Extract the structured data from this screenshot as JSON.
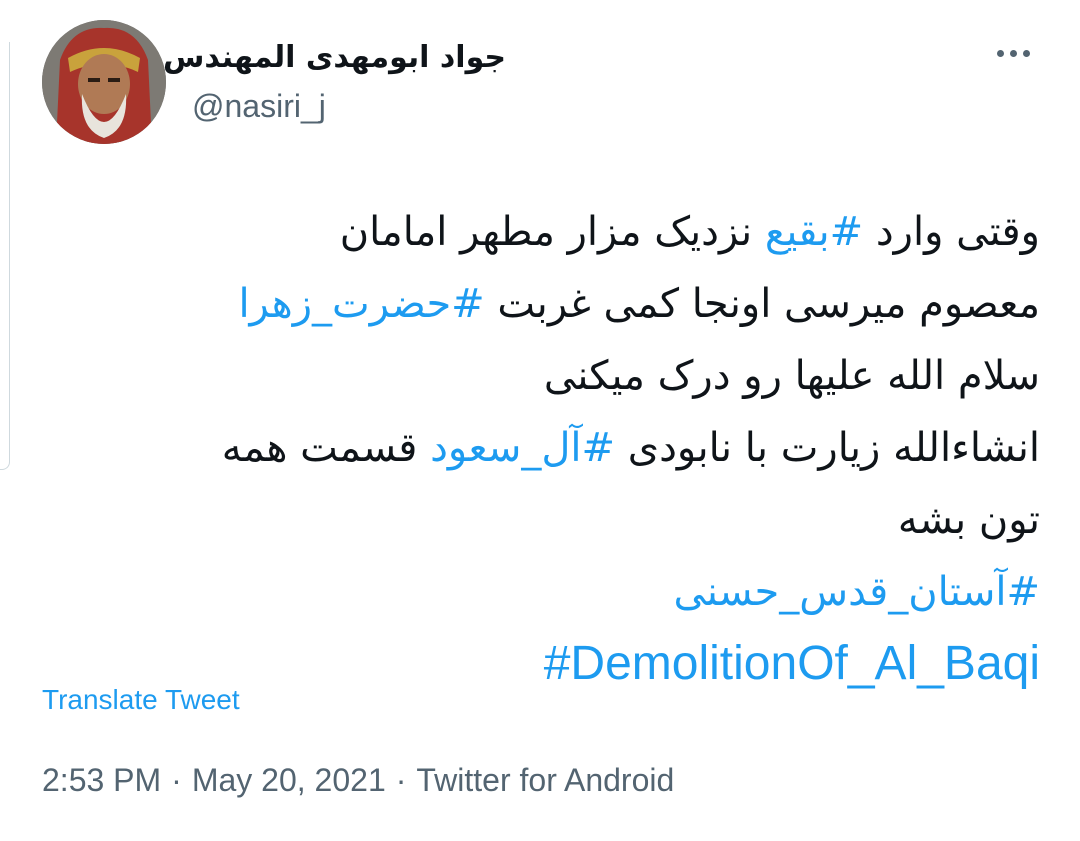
{
  "author": {
    "display_name": "جواد ابومهدی المهندس",
    "handle": "@nasiri_j"
  },
  "tweet": {
    "lines": [
      [
        {
          "t": "وقتی وارد ",
          "tag": false
        },
        {
          "t": "#بقیع",
          "tag": true
        },
        {
          "t": " نزدیک مزار مطهر امامان",
          "tag": false
        }
      ],
      [
        {
          "t": "معصوم میرسی اونجا کمی غربت ",
          "tag": false
        },
        {
          "t": "#حضرت_زهرا",
          "tag": true
        }
      ],
      [
        {
          "t": "سلام الله علیها رو درک میکنی",
          "tag": false
        }
      ],
      [
        {
          "t": "انشاءالله زیارت با نابودی ",
          "tag": false
        },
        {
          "t": "#آل_سعود",
          "tag": true
        },
        {
          "t": " قسمت همه",
          "tag": false
        }
      ],
      [
        {
          "t": "تون بشه",
          "tag": false
        }
      ],
      [
        {
          "t": "#آستان_قدس_حسنی",
          "tag": true
        }
      ],
      [
        {
          "t": "#DemolitionOf_Al_Baqi",
          "tag": true,
          "latin": true
        }
      ]
    ]
  },
  "translate_label": "Translate Tweet",
  "meta": {
    "time": "2:53 PM",
    "date": "May 20, 2021",
    "source": "Twitter for Android",
    "separator": "·"
  },
  "icons": {
    "more": "more-horizontal-icon",
    "avatar": "avatar-image"
  },
  "colors": {
    "link": "#1d9bf0",
    "secondary": "#536471",
    "text": "#0f1419"
  }
}
